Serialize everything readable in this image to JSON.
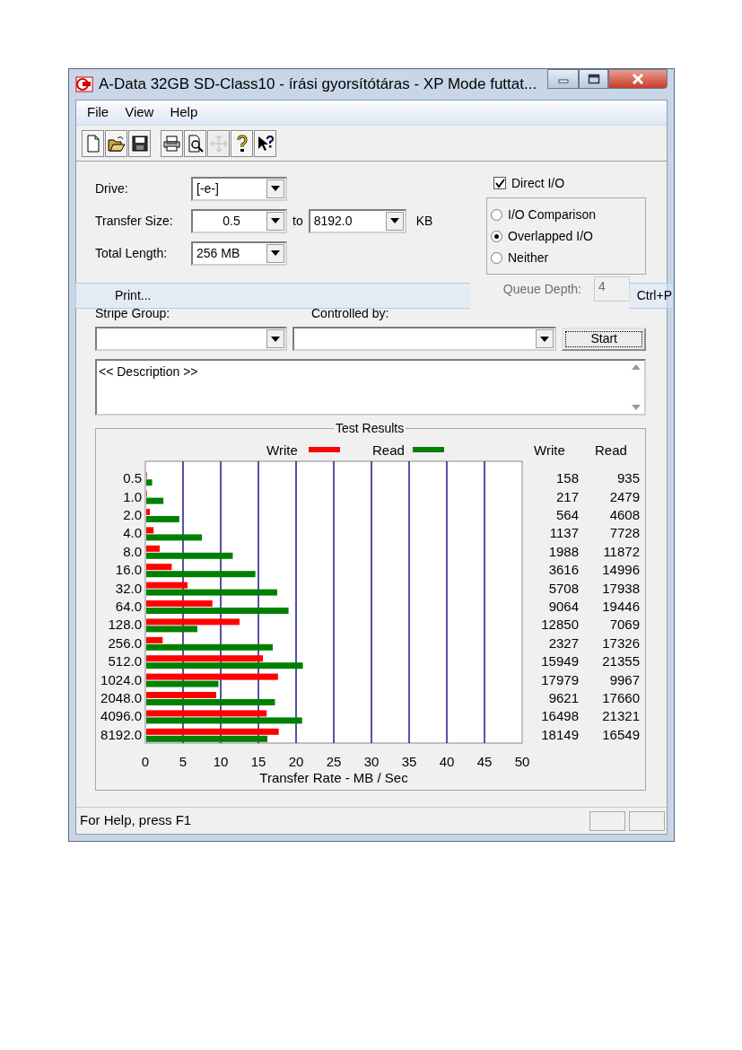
{
  "window": {
    "title": "A-Data 32GB SD-Class10 - írási gyorsítótáras - XP Mode futtat..."
  },
  "menu": [
    "File",
    "View",
    "Help"
  ],
  "toolbar": [
    {
      "disabled": false
    },
    {
      "disabled": false
    },
    {
      "disabled": false
    },
    {
      "disabled": false
    },
    {
      "disabled": false
    },
    {
      "disabled": true
    },
    {
      "disabled": false
    },
    {
      "disabled": false
    }
  ],
  "form": {
    "drive": {
      "label": "Drive:",
      "value": "[-e-]"
    },
    "transfer_size": {
      "label": "Transfer Size:",
      "from": "0.5",
      "to_label": "to",
      "to": "8192.0",
      "unit": "KB"
    },
    "total_length": {
      "label": "Total Length:",
      "value": "256 MB"
    },
    "direct_io": {
      "label": "Direct I/O",
      "checked": true
    },
    "io_mode": [
      {
        "label": "I/O Comparison",
        "selected": false
      },
      {
        "label": "Overlapped I/O",
        "selected": true
      },
      {
        "label": "Neither",
        "selected": false
      }
    ],
    "queue_depth": {
      "label": "Queue Depth:",
      "value": "4",
      "disabled": true
    },
    "stripe_group": {
      "label": "Stripe Group:"
    },
    "controlled_by": {
      "label": "Controlled by:"
    },
    "start_button": "Start",
    "description": "<< Description >>"
  },
  "context_menu_item": {
    "label": "Print...",
    "shortcut": "Ctrl+P"
  },
  "results": {
    "title": "Test Results",
    "columns": [
      "Write",
      "Read"
    ],
    "rows": [
      {
        "write": "158",
        "read": "935"
      },
      {
        "write": "217",
        "read": "2479"
      },
      {
        "write": "564",
        "read": "4608"
      },
      {
        "write": "1137",
        "read": "7728"
      },
      {
        "write": "1988",
        "read": "11872"
      },
      {
        "write": "3616",
        "read": "14996"
      },
      {
        "write": "5708",
        "read": "17938"
      },
      {
        "write": "9064",
        "read": "19446"
      },
      {
        "write": "12850",
        "read": "7069"
      },
      {
        "write": "2327",
        "read": "17326"
      },
      {
        "write": "15949",
        "read": "21355"
      },
      {
        "write": "17979",
        "read": "9967"
      },
      {
        "write": "9621",
        "read": "17660"
      },
      {
        "write": "16498",
        "read": "21321"
      },
      {
        "write": "18149",
        "read": "16549"
      }
    ],
    "chart_data": {
      "type": "bar",
      "orientation": "horizontal",
      "xlabel": "Transfer Rate - MB / Sec",
      "categories": [
        "0.5",
        "1.0",
        "2.0",
        "4.0",
        "8.0",
        "16.0",
        "32.0",
        "64.0",
        "128.0",
        "256.0",
        "512.0",
        "1024.0",
        "2048.0",
        "4096.0",
        "8192.0"
      ],
      "series": [
        {
          "name": "Write",
          "color": "#ff0000",
          "values": [
            0.2,
            0.2,
            0.6,
            1.1,
            1.9,
            3.5,
            5.6,
            8.9,
            12.5,
            2.3,
            15.6,
            17.6,
            9.4,
            16.1,
            17.7
          ]
        },
        {
          "name": "Read",
          "color": "#008000",
          "values": [
            0.9,
            2.4,
            4.5,
            7.5,
            11.6,
            14.6,
            17.5,
            19.0,
            6.9,
            16.9,
            20.9,
            9.7,
            17.2,
            20.8,
            16.2
          ]
        }
      ],
      "grid": true,
      "legend": "top",
      "xlim": [
        0,
        50
      ],
      "xticks": [
        0,
        5,
        10,
        15,
        20,
        25,
        30,
        35,
        40,
        45,
        50
      ]
    }
  },
  "status_bar": {
    "text": "For Help, press F1"
  }
}
